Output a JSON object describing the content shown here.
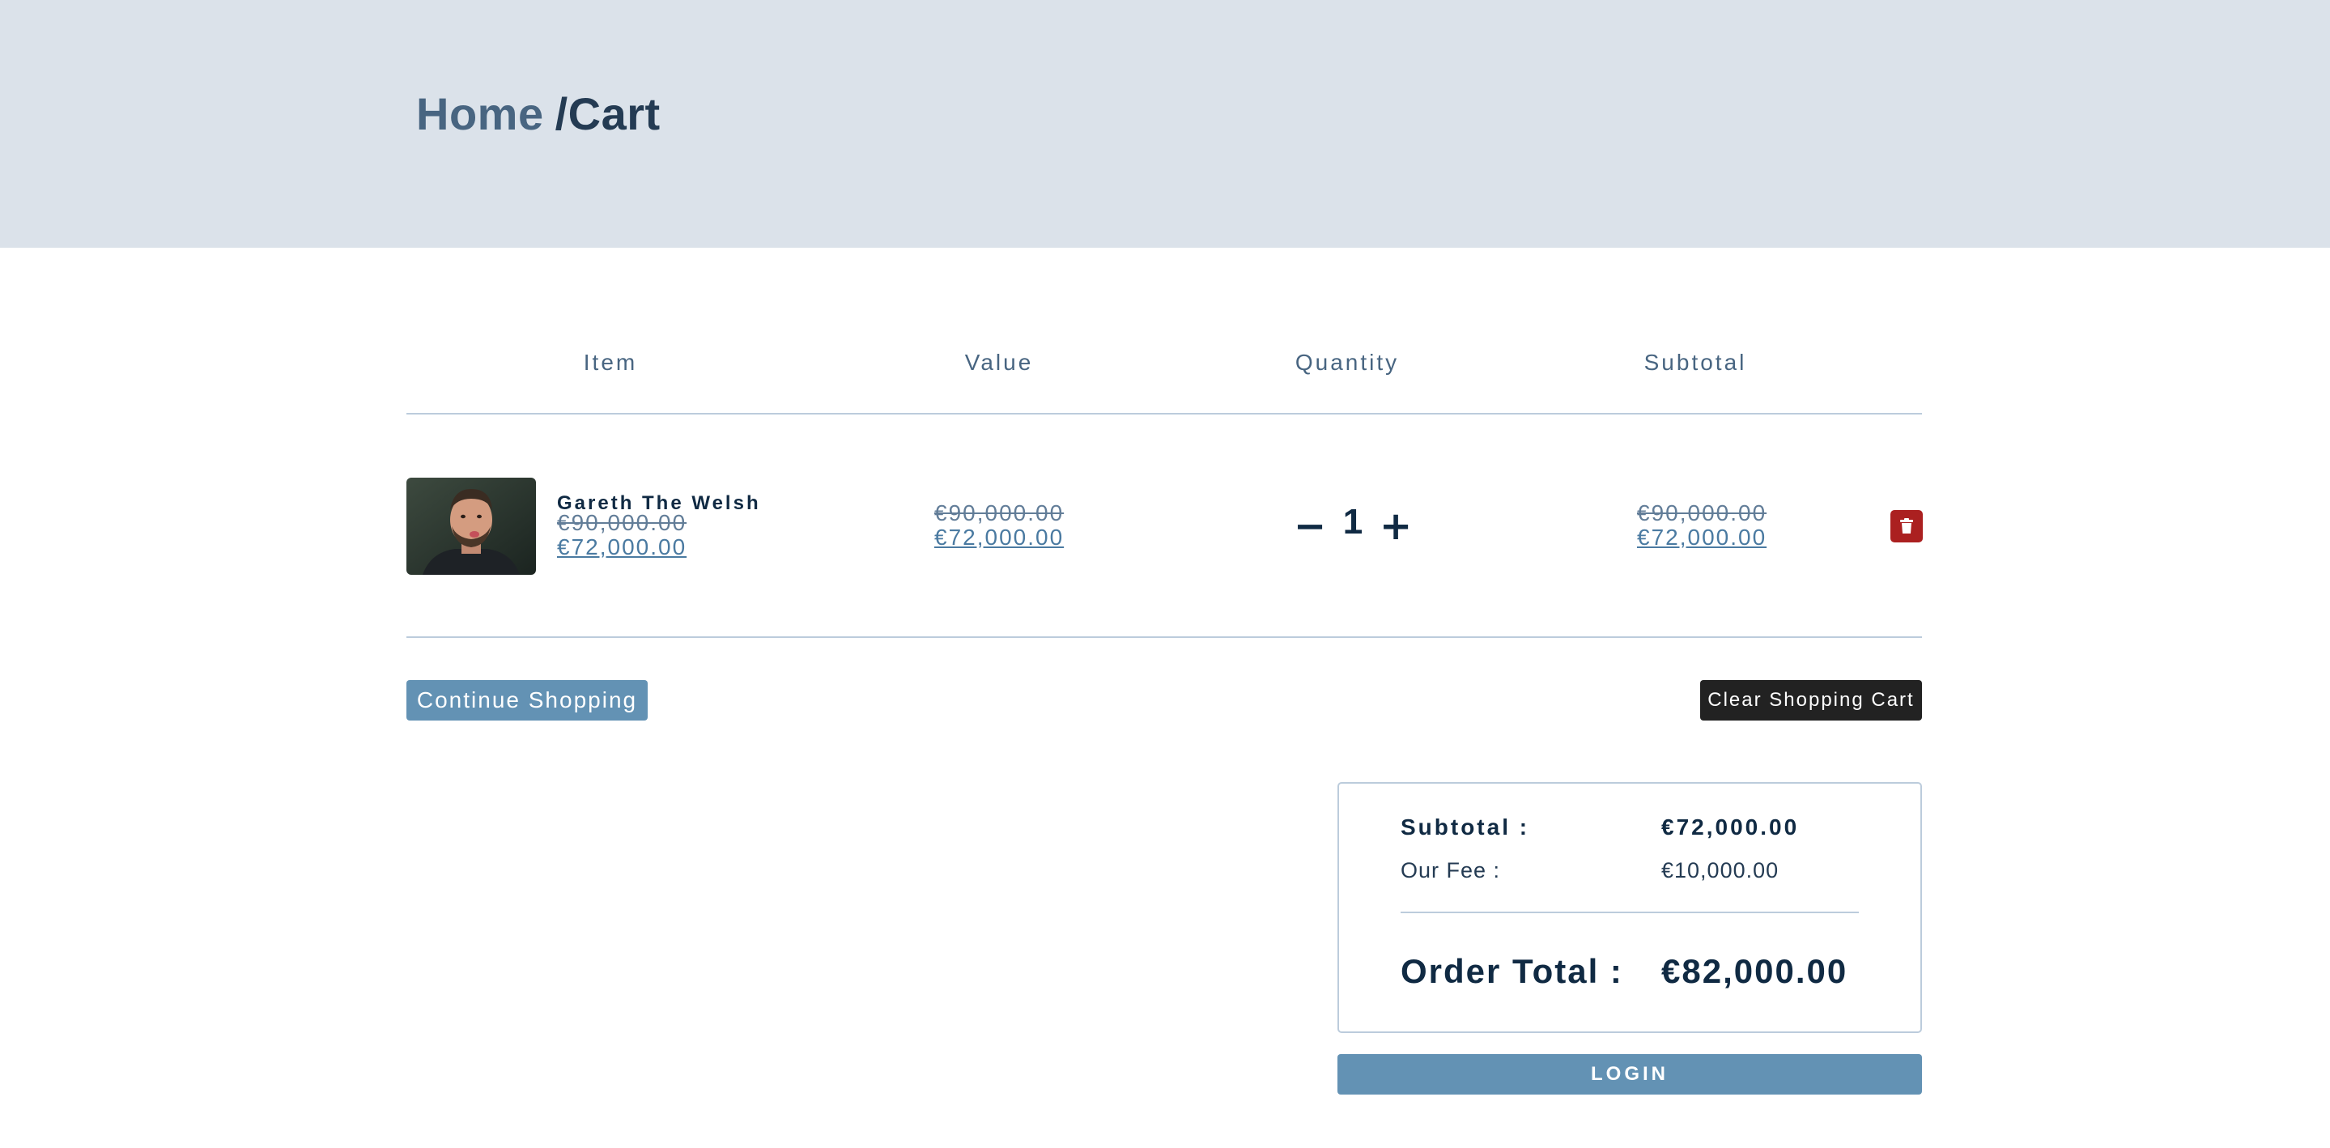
{
  "breadcrumb": {
    "home": "Home",
    "current": "/Cart"
  },
  "columns": {
    "item": "Item",
    "value": "Value",
    "quantity": "Quantity",
    "subtotal": "Subtotal"
  },
  "cart_item": {
    "name": "Gareth The Welsh",
    "image": "player-photo",
    "old_price": "€90,000.00",
    "new_price": "€72,000.00",
    "value_old": "€90,000.00",
    "value_new": "€72,000.00",
    "quantity": "1",
    "decrease_icon": "minus-icon",
    "decrease_label": "−",
    "increase_icon": "plus-icon",
    "increase_label": "+",
    "subtotal_old": "€90,000.00",
    "subtotal_new": "€72,000.00",
    "remove_icon": "trash-icon"
  },
  "actions": {
    "continue": "Continue Shopping",
    "clear": "Clear Shopping Cart"
  },
  "totals": {
    "subtotal_label": "Subtotal :",
    "subtotal_value": "€72,000.00",
    "fee_label": "Our Fee :",
    "fee_value": "€10,000.00",
    "order_total_label": "Order Total :",
    "order_total_value": "€82,000.00"
  },
  "login": {
    "label": "LOGIN"
  },
  "colors": {
    "header_bg": "#dbe2ea",
    "primary": "#6392b4",
    "dark": "#222222",
    "danger": "#ab2020"
  }
}
